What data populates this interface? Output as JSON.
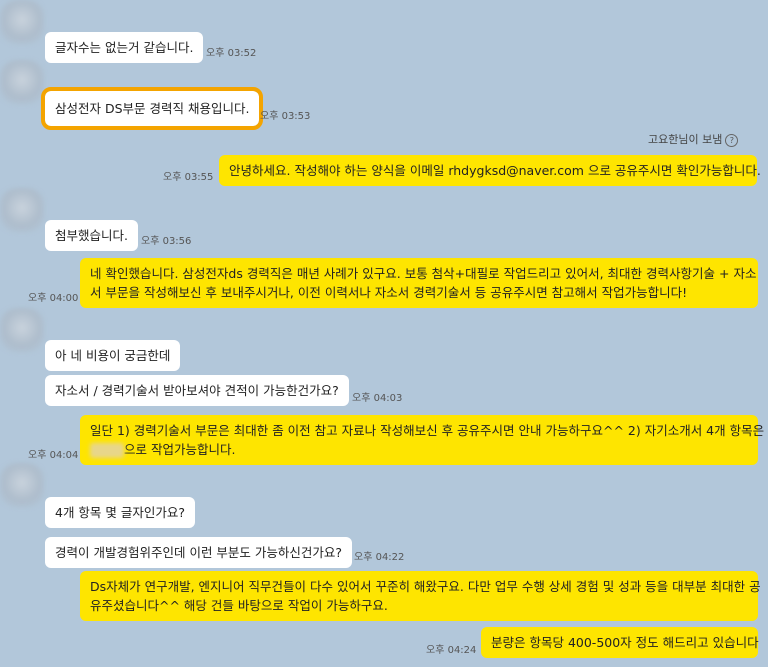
{
  "messages": {
    "m1": {
      "text": "글자수는 없는거 같습니다.",
      "time": "오후 03:52"
    },
    "m2": {
      "text": "삼성전자 DS부문 경력직 채용입니다.",
      "time": "오후 03:53"
    },
    "sender_note": "고요한님이 보냄",
    "m3": {
      "text": "안녕하세요. 작성해야 하는 양식을 이메일 rhdygksd@naver.com 으로 공유주시면 확인가능합니다.",
      "time": "오후 03:55"
    },
    "m4": {
      "text": "첨부했습니다.",
      "time": "오후 03:56"
    },
    "m5": {
      "line1": "네 확인했습니다. 삼성전자ds 경력직은 매년 사례가 있구요. 보통 첨삭+대필로 작업드리고 있어서, 최대한 경력사항기술 + 자소",
      "line2": "서 부문을 작성해보신 후 보내주시거나, 이전 이력서나 자소서 경력기술서 등 공유주시면 참고해서 작업가능합니다!",
      "time": "오후 04:00"
    },
    "m6": {
      "text": "아 네 비용이 궁금한데"
    },
    "m7": {
      "text": "자소서 / 경력기술서 받아보셔야 견적이 가능한건가요?",
      "time": "오후 04:03"
    },
    "m8": {
      "line1": "일단 1) 경력기술서 부문은 최대한 좀 이전 참고 자료나 작성해보신 후 공유주시면 안내 가능하구요^^ 2) 자기소개서 4개 항목은",
      "line2_suffix": "으로 작업가능합니다.",
      "time": "오후 04:04"
    },
    "m9": {
      "text": "4개 항목 몇 글자인가요?"
    },
    "m10": {
      "text": "경력이 개발경험위주인데 이런 부분도 가능하신건가요?",
      "time": "오후 04:22"
    },
    "m11": {
      "line1": "Ds자체가 연구개발, 엔지니어 직무건들이 다수 있어서 꾸준히 해왔구요. 다만 업무 수행 상세 경험 및 성과 등을 대부분 최대한 공",
      "line2": "유주셨습니다^^ 해당 건들 바탕으로 작업이 가능하구요."
    },
    "m12": {
      "text": "분량은 항목당 400-500자 정도 해드리고 있습니다",
      "time": "오후 04:24"
    }
  },
  "colors": {
    "background": "#b2c7da",
    "outgoing": "#fee500",
    "incoming": "#ffffff",
    "highlight": "#f4a400"
  }
}
